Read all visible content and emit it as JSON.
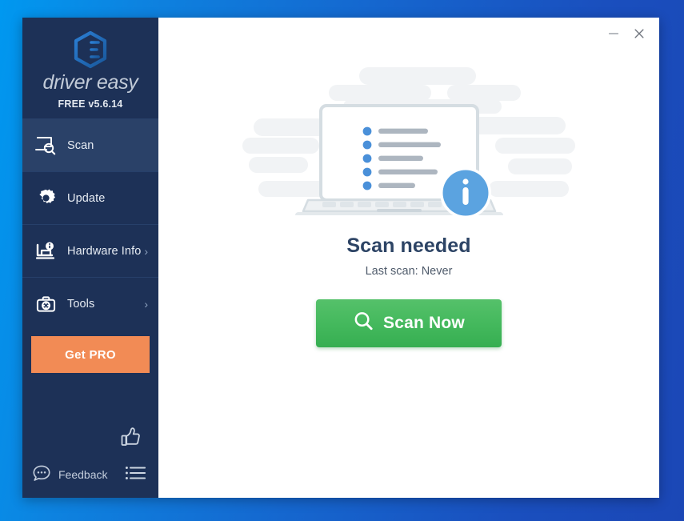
{
  "app": {
    "brand_name": "driver easy",
    "version_label": "FREE v5.6.14",
    "logo_icon": "driver-easy-hexagon-logo"
  },
  "titlebar": {
    "minimize_icon": "minimize-icon",
    "close_icon": "close-icon"
  },
  "sidebar": {
    "items": [
      {
        "label": "Scan",
        "icon": "scan-monitor-magnifier-icon",
        "active": true,
        "chevron": ""
      },
      {
        "label": "Update",
        "icon": "gear-icon",
        "active": false,
        "chevron": ""
      },
      {
        "label": "Hardware Info",
        "icon": "hardware-info-icon",
        "active": false,
        "chevron": "›"
      },
      {
        "label": "Tools",
        "icon": "toolbox-icon",
        "active": false,
        "chevron": "›"
      }
    ],
    "pro_button_label": "Get PRO",
    "feedback_label": "Feedback",
    "feedback_icon": "speech-bubble-icon",
    "thumbs_up_icon": "thumbs-up-icon",
    "menu_icon": "list-menu-icon"
  },
  "main": {
    "illustration": "laptop-driver-list-info-badge",
    "status_title": "Scan needed",
    "status_subtitle": "Last scan: Never",
    "scan_button_label": "Scan Now",
    "scan_button_icon": "magnifier-icon"
  },
  "colors": {
    "sidebar_bg": "#1d3157",
    "sidebar_active": "#2a4168",
    "accent_orange": "#f28b55",
    "accent_green": "#43b85c",
    "accent_blue": "#4a90d9",
    "title_text": "#2d4465",
    "desktop_blue_left": "#0098f0",
    "desktop_blue_right": "#1b47b6"
  }
}
